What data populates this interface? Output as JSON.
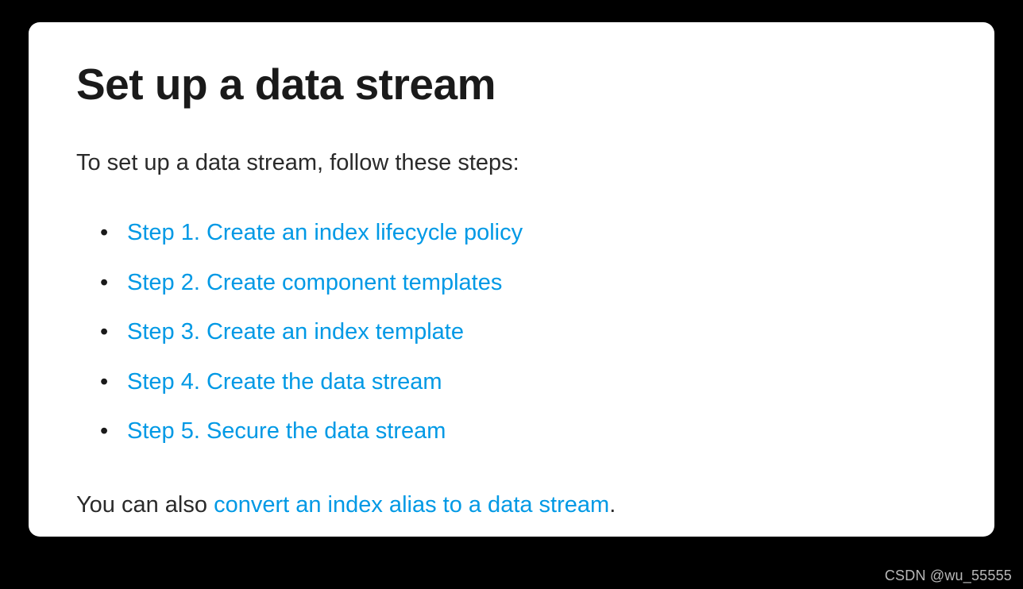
{
  "heading": "Set up a data stream",
  "intro": "To set up a data stream, follow these steps:",
  "steps": [
    "Step 1. Create an index lifecycle policy",
    "Step 2. Create component templates",
    "Step 3. Create an index template",
    "Step 4. Create the data stream",
    "Step 5. Secure the data stream"
  ],
  "footer": {
    "prefix": "You can also ",
    "link": "convert an index alias to a data stream",
    "suffix": "."
  },
  "watermark": "CSDN @wu_55555"
}
